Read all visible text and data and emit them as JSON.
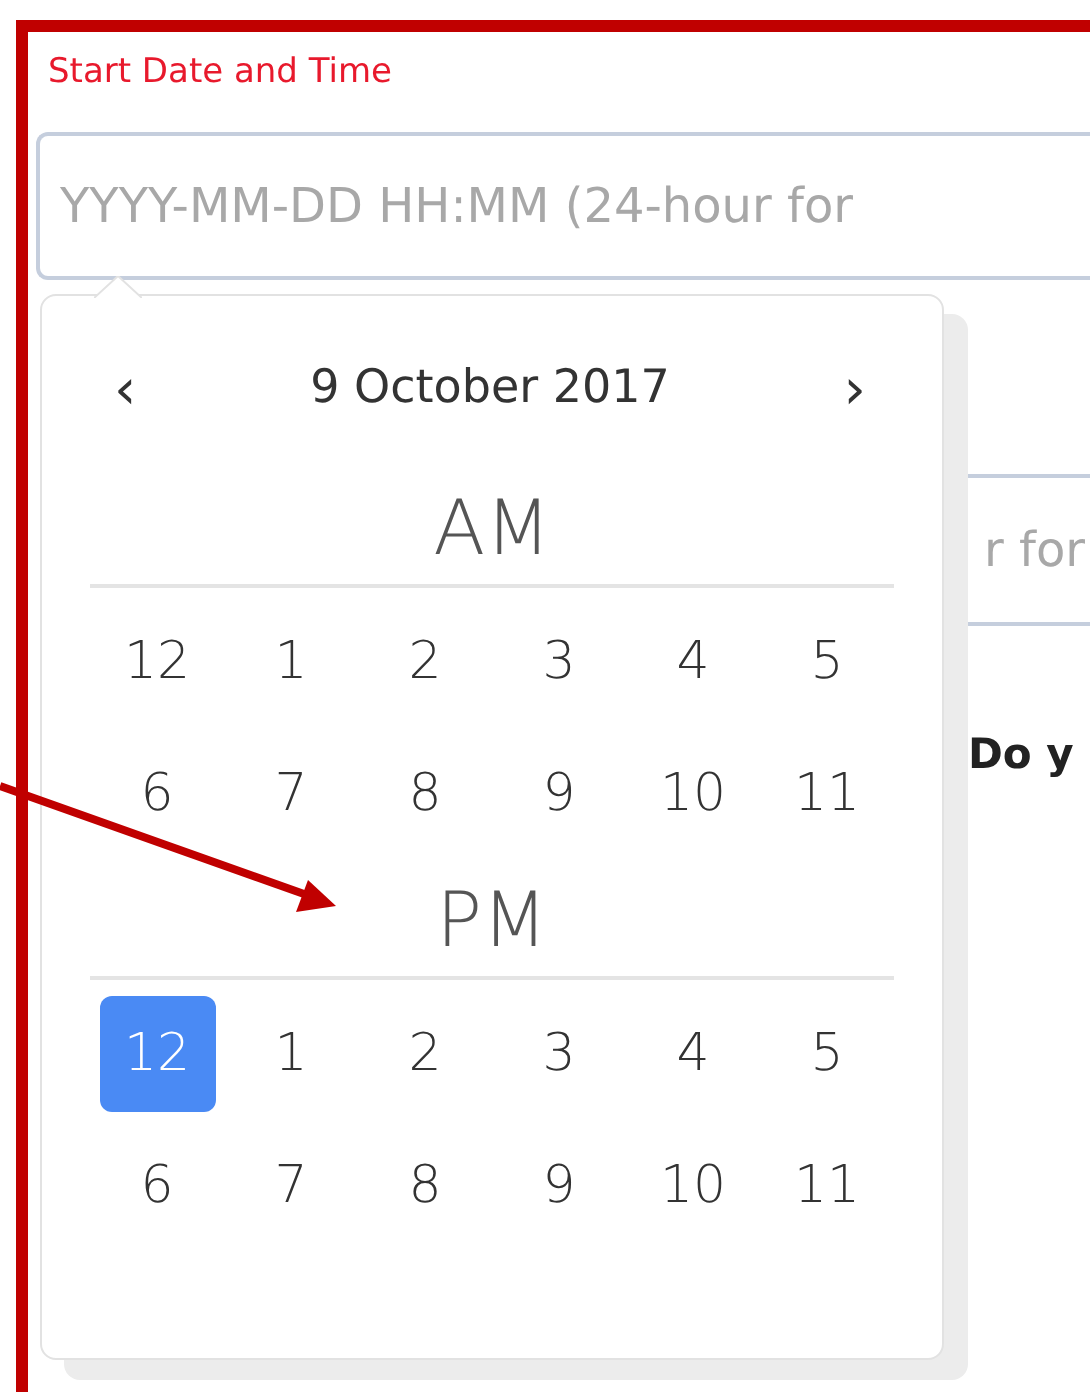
{
  "field": {
    "label": "Start Date and Time",
    "placeholder": "YYYY-MM-DD HH:MM (24-hour for"
  },
  "picker": {
    "prev": "‹",
    "title": "9 October 2017",
    "next": "›",
    "periods": [
      {
        "label": "AM",
        "hours": [
          {
            "label": "12",
            "selected": false
          },
          {
            "label": "1",
            "selected": false
          },
          {
            "label": "2",
            "selected": false
          },
          {
            "label": "3",
            "selected": false
          },
          {
            "label": "4",
            "selected": false
          },
          {
            "label": "5",
            "selected": false
          },
          {
            "label": "6",
            "selected": false
          },
          {
            "label": "7",
            "selected": false
          },
          {
            "label": "8",
            "selected": false
          },
          {
            "label": "9",
            "selected": false
          },
          {
            "label": "10",
            "selected": false
          },
          {
            "label": "11",
            "selected": false
          }
        ]
      },
      {
        "label": "PM",
        "hours": [
          {
            "label": "12",
            "selected": true
          },
          {
            "label": "1",
            "selected": false
          },
          {
            "label": "2",
            "selected": false
          },
          {
            "label": "3",
            "selected": false
          },
          {
            "label": "4",
            "selected": false
          },
          {
            "label": "5",
            "selected": false
          },
          {
            "label": "6",
            "selected": false
          },
          {
            "label": "7",
            "selected": false
          },
          {
            "label": "8",
            "selected": false
          },
          {
            "label": "9",
            "selected": false
          },
          {
            "label": "10",
            "selected": false
          },
          {
            "label": "11",
            "selected": false
          }
        ]
      }
    ]
  },
  "background": {
    "field_placeholder": "r for",
    "text": "Do y"
  }
}
